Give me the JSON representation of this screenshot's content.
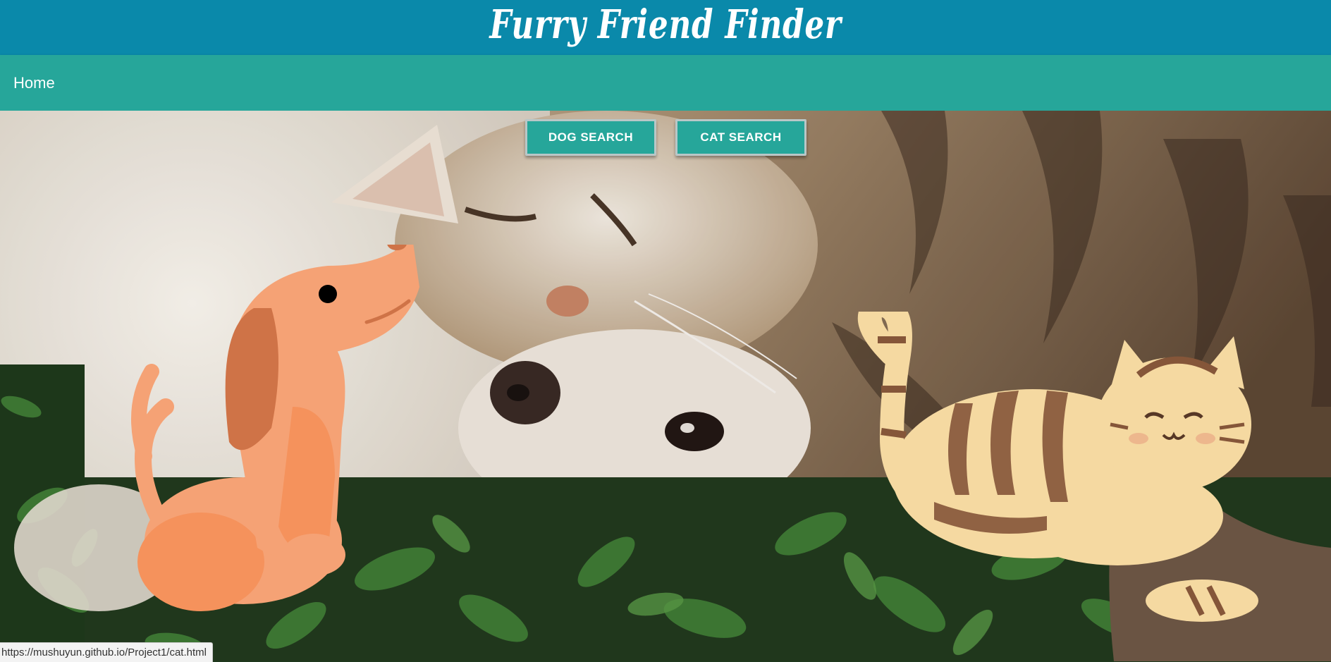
{
  "header": {
    "title": "Furry Friend Finder"
  },
  "nav": {
    "home_label": "Home"
  },
  "buttons": {
    "dog_search": "DOG SEARCH",
    "cat_search": "CAT SEARCH"
  },
  "status_bar": {
    "url": "https://mushuyun.github.io/Project1/cat.html"
  },
  "colors": {
    "title_bar": "#0a89aa",
    "nav_bar": "#26a69a",
    "button": "#26a69a",
    "text": "#ffffff"
  },
  "illustrations": [
    "dog-illustration",
    "cat-illustration",
    "hero-photo-cat-and-dog"
  ]
}
